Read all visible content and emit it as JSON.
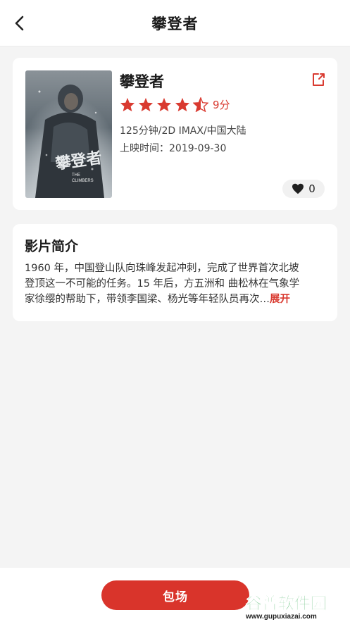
{
  "nav": {
    "title": "攀登者"
  },
  "movie": {
    "name": "攀登者",
    "score": "9分",
    "rating_stars": 4.5,
    "meta_line": "125分钟/2D IMAX/中国大陆",
    "release": "上映时间：2019-09-30",
    "likes": "0",
    "poster_title": "攀登者",
    "poster_subtitle": "THE CLIMBERS"
  },
  "intro": {
    "title": "影片简介",
    "text_line1": "1960 年，中国登山队向珠峰发起冲刺，完成了世界首次北坡",
    "text_line2": "登顶这一不可能的任务。15 年后，方五洲和 曲松林在气象学",
    "text_line3": "家徐缨的帮助下，带领李国梁、杨光等年轻队员再次…",
    "more_label": "展开"
  },
  "bottom": {
    "book_label": "包场"
  },
  "watermark": {
    "brand": "谷普软件园",
    "url": "www.gupuxiazai.com"
  },
  "colors": {
    "accent": "#d9342b",
    "background": "#f4f4f4"
  }
}
